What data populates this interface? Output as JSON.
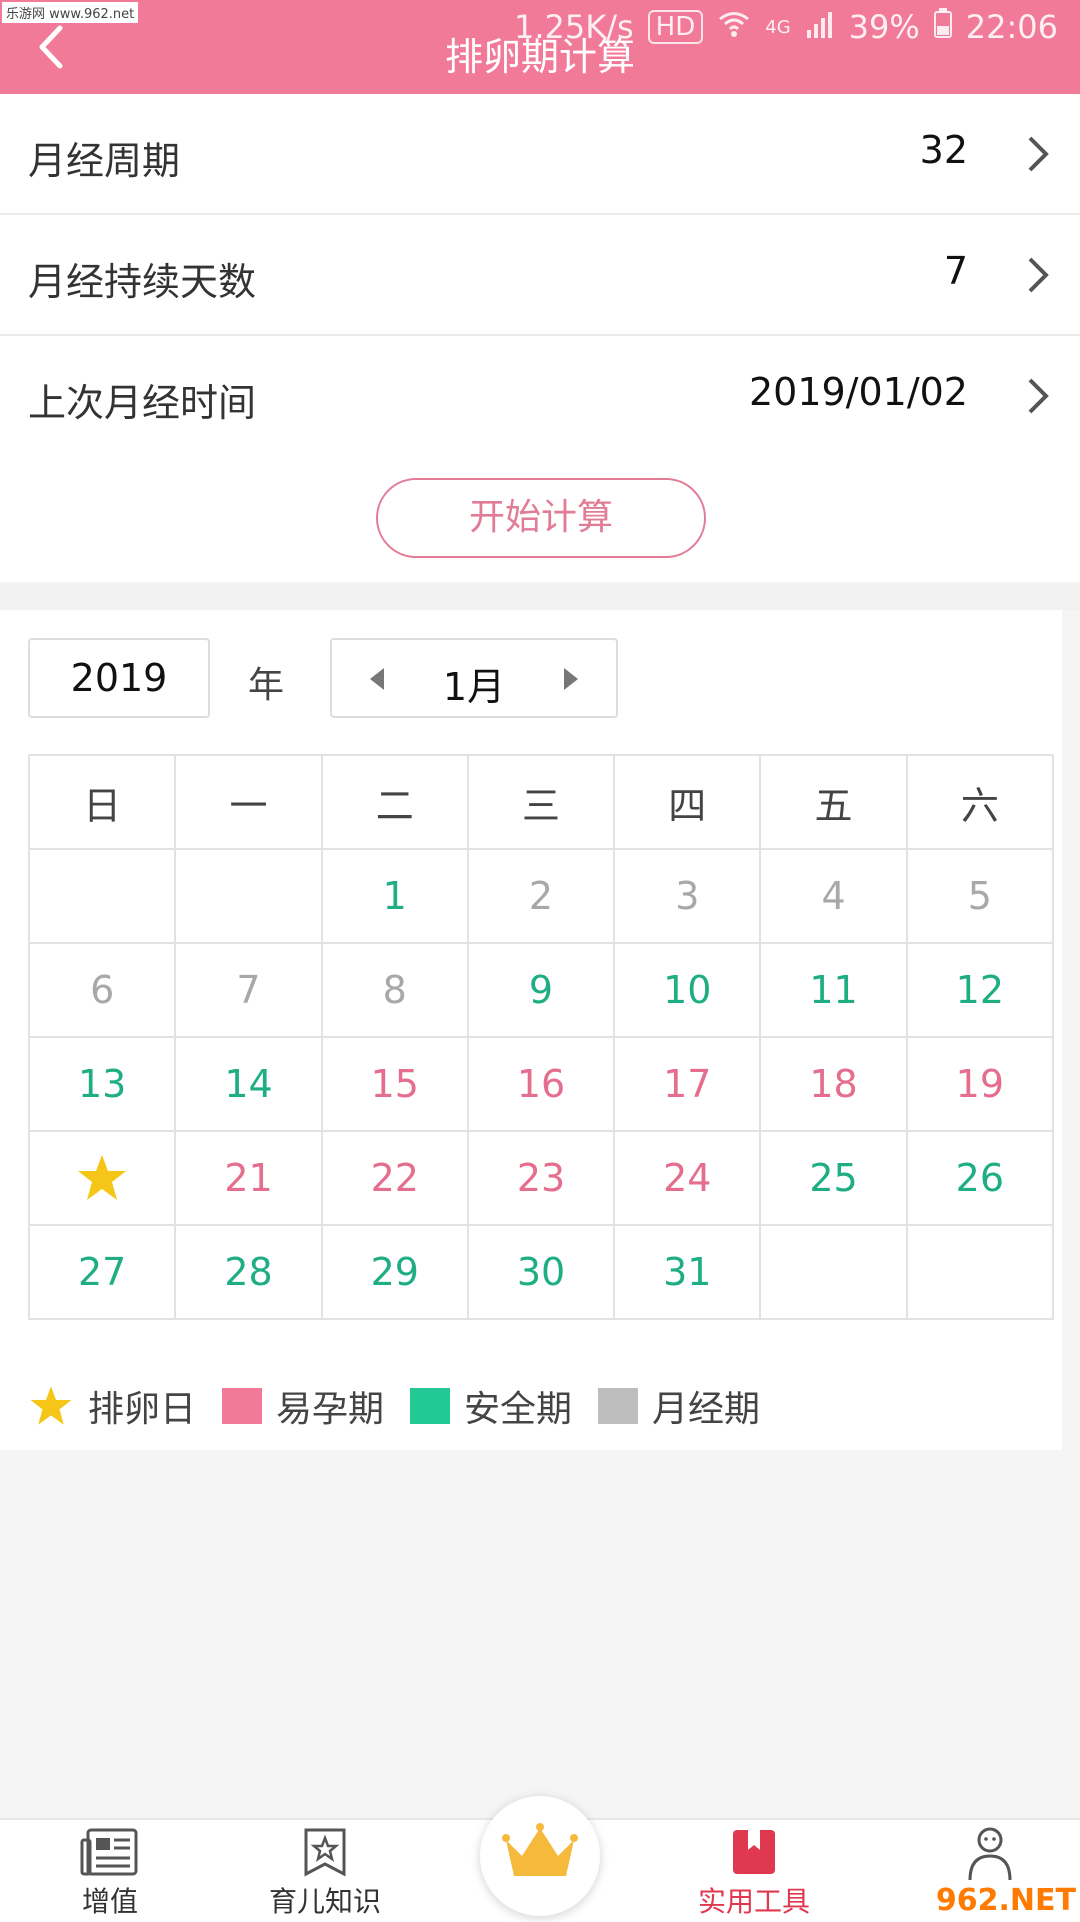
{
  "watermark": "乐游网 www.962.net",
  "status": {
    "speed": "1.25K/s",
    "hd": "HD",
    "net": "4G",
    "battery": "39%",
    "time": "22:06"
  },
  "header": {
    "title": "排卵期计算"
  },
  "settings": [
    {
      "label": "月经周期",
      "value": "32"
    },
    {
      "label": "月经持续天数",
      "value": "7"
    },
    {
      "label": "上次月经时间",
      "value": "2019/01/02"
    }
  ],
  "calc_button": "开始计算",
  "calendar": {
    "year": "2019",
    "year_label": "年",
    "month": "1月",
    "weekdays": [
      "日",
      "一",
      "二",
      "三",
      "四",
      "五",
      "六"
    ],
    "weeks": [
      [
        {
          "d": "",
          "t": ""
        },
        {
          "d": "",
          "t": ""
        },
        {
          "d": "1",
          "t": "safe"
        },
        {
          "d": "2",
          "t": "mens"
        },
        {
          "d": "3",
          "t": "mens"
        },
        {
          "d": "4",
          "t": "mens"
        },
        {
          "d": "5",
          "t": "mens"
        }
      ],
      [
        {
          "d": "6",
          "t": "mens"
        },
        {
          "d": "7",
          "t": "mens"
        },
        {
          "d": "8",
          "t": "mens"
        },
        {
          "d": "9",
          "t": "safe"
        },
        {
          "d": "10",
          "t": "safe"
        },
        {
          "d": "11",
          "t": "safe"
        },
        {
          "d": "12",
          "t": "safe"
        }
      ],
      [
        {
          "d": "13",
          "t": "safe"
        },
        {
          "d": "14",
          "t": "safe"
        },
        {
          "d": "15",
          "t": "fert"
        },
        {
          "d": "16",
          "t": "fert"
        },
        {
          "d": "17",
          "t": "fert"
        },
        {
          "d": "18",
          "t": "fert"
        },
        {
          "d": "19",
          "t": "fert"
        }
      ],
      [
        {
          "d": "",
          "t": "ovul"
        },
        {
          "d": "21",
          "t": "fert"
        },
        {
          "d": "22",
          "t": "fert"
        },
        {
          "d": "23",
          "t": "fert"
        },
        {
          "d": "24",
          "t": "fert"
        },
        {
          "d": "25",
          "t": "safe"
        },
        {
          "d": "26",
          "t": "safe"
        }
      ],
      [
        {
          "d": "27",
          "t": "safe"
        },
        {
          "d": "28",
          "t": "safe"
        },
        {
          "d": "29",
          "t": "safe"
        },
        {
          "d": "30",
          "t": "safe"
        },
        {
          "d": "31",
          "t": "safe"
        },
        {
          "d": "",
          "t": ""
        },
        {
          "d": "",
          "t": ""
        }
      ]
    ]
  },
  "legend": [
    {
      "label": "排卵日",
      "type": "star",
      "color": "#f5c518"
    },
    {
      "label": "易孕期",
      "type": "swatch",
      "color": "#f07a98"
    },
    {
      "label": "安全期",
      "type": "swatch",
      "color": "#22c994"
    },
    {
      "label": "月经期",
      "type": "swatch",
      "color": "#bdbdbd"
    }
  ],
  "colors": {
    "brand": "#f07a98",
    "fertile": "#e56d8e",
    "safe": "#1fae84",
    "menstrual": "#a8a8a8",
    "active_nav": "#e0384f"
  },
  "nav": [
    {
      "label": "增值",
      "icon": "newspaper-icon"
    },
    {
      "label": "育儿知识",
      "icon": "star-bookmark-icon"
    },
    {
      "label": "",
      "icon": "crown-icon"
    },
    {
      "label": "实用工具",
      "icon": "red-bookmark-icon",
      "active": true
    },
    {
      "label": "",
      "icon": "person-icon"
    }
  ],
  "logo_watermark": "962.NET"
}
